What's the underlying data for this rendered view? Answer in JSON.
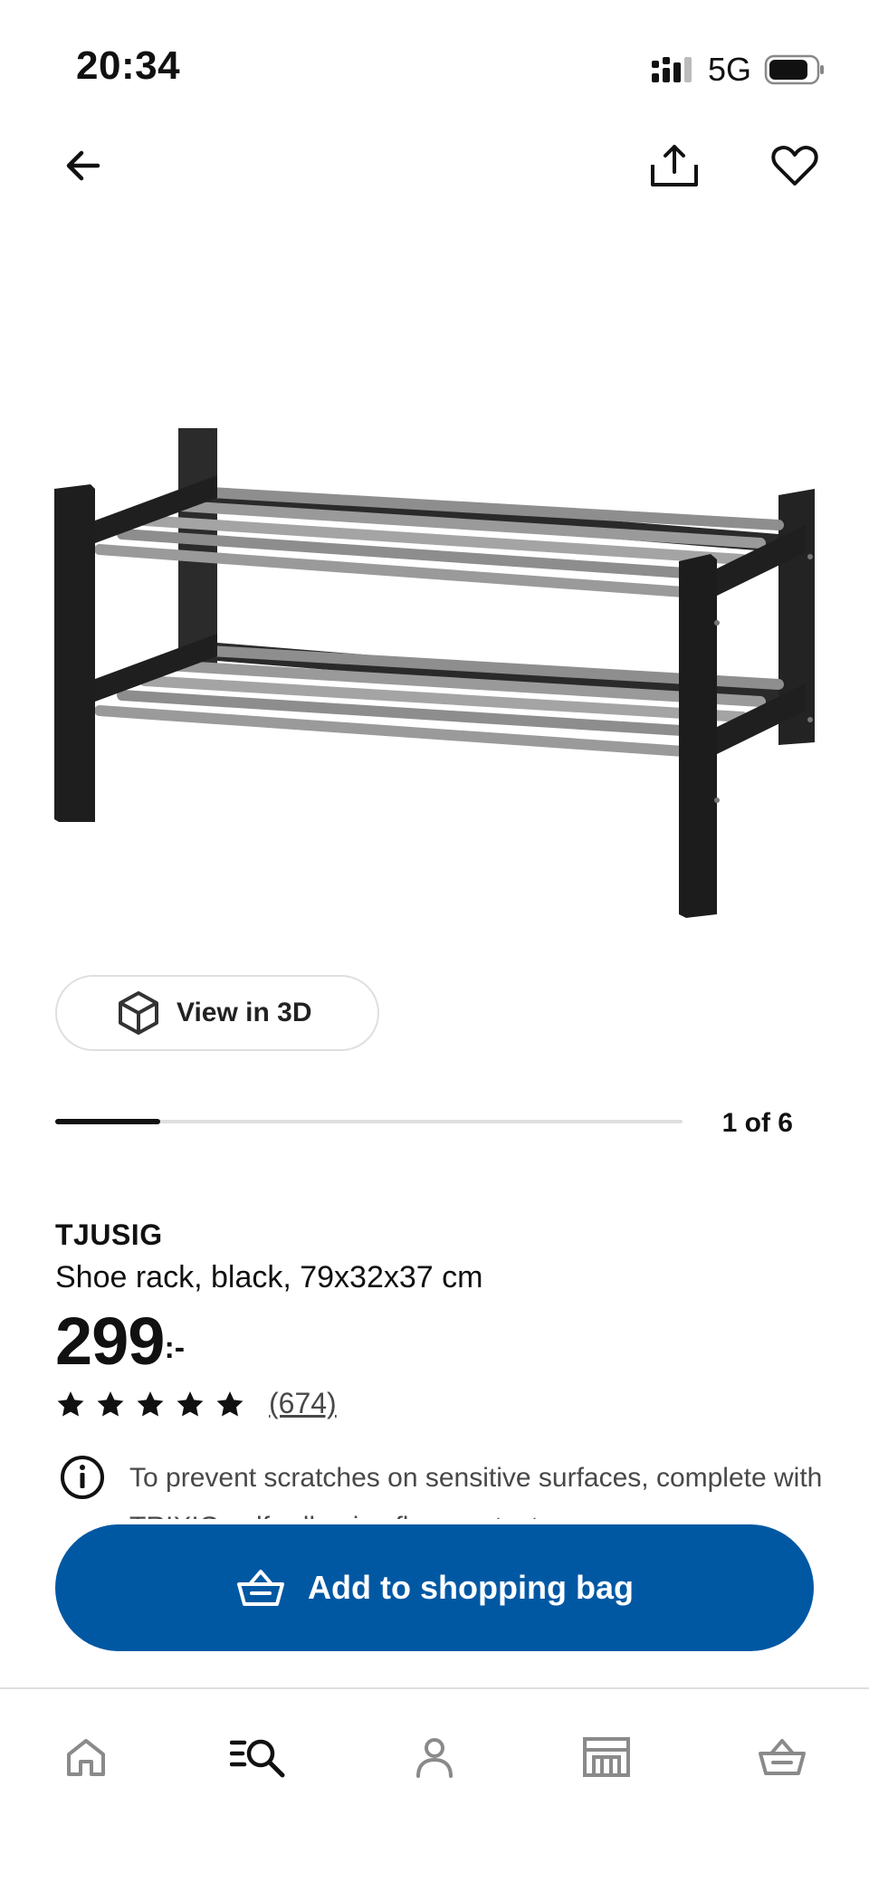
{
  "status_bar": {
    "time": "20:34",
    "network": "5G"
  },
  "top_nav": {
    "back_icon": "arrow-left-icon",
    "share_icon": "share-icon",
    "favorite_icon": "heart-icon"
  },
  "gallery": {
    "view_3d_label": "View in 3D",
    "counter": "1 of 6",
    "current": 1,
    "total": 6
  },
  "product": {
    "name": "TJUSIG",
    "description": "Shoe rack, black, 79x32x37 cm",
    "price": "299",
    "price_suffix": ":-",
    "rating": 5,
    "review_count": "(674)",
    "info_text": "To prevent scratches on sensitive surfaces, complete with TRIXIG self-adhesive floor protectors,"
  },
  "cta": {
    "label": "Add to shopping bag",
    "color": "#0058a3"
  },
  "tab_bar": {
    "items": [
      "home-icon",
      "search-icon",
      "profile-icon",
      "store-icon",
      "shopping-bag-icon"
    ],
    "active": "search-icon"
  }
}
